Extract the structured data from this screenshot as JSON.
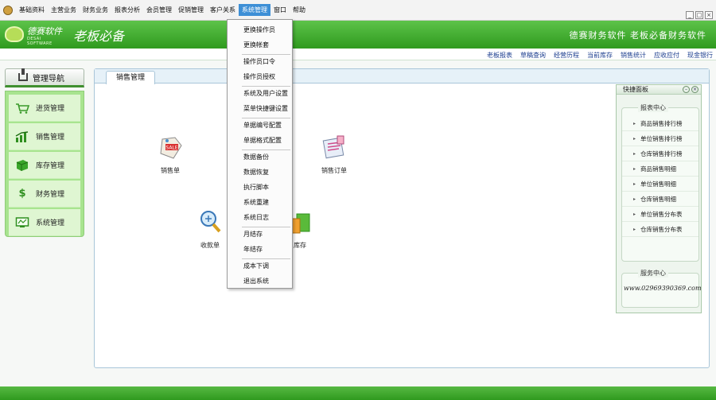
{
  "menubar": {
    "items": [
      "基础资料",
      "主营业务",
      "财务业务",
      "报表分析",
      "会员管理",
      "促销管理",
      "客户关系",
      "系统管理",
      "窗口",
      "帮助"
    ],
    "active_index": 7
  },
  "window_controls": [
    "_",
    "□",
    "×"
  ],
  "banner": {
    "logo_name": "德赛软件",
    "logo_sub": "DESAI SOFTWARE",
    "title": "老板必备",
    "slogan": "德赛财务软件 老板必备财务软件"
  },
  "quicklinks": [
    "老板报表",
    "草稿查询",
    "经营历程",
    "当前库存",
    "销售统计",
    "应收应付",
    "现金银行"
  ],
  "nav": {
    "header": "管理导航",
    "items": [
      {
        "label": "进货管理",
        "icon": "shopping-cart-icon"
      },
      {
        "label": "销售管理",
        "icon": "sales-chart-icon"
      },
      {
        "label": "库存管理",
        "icon": "inventory-icon"
      },
      {
        "label": "财务管理",
        "icon": "dollar-icon"
      },
      {
        "label": "系统管理",
        "icon": "system-monitor-icon"
      }
    ]
  },
  "content": {
    "tab": "销售管理",
    "functions": [
      {
        "label": "销售单",
        "icon": "sale-tag-icon"
      },
      {
        "label": "销售订单",
        "icon": "sales-order-icon"
      },
      {
        "label": "收款单",
        "icon": "receipt-magnifier-icon"
      },
      {
        "label": "库存",
        "icon": "stock-bag-icon"
      }
    ]
  },
  "quick_panel": {
    "title": "快捷面板",
    "report_center": {
      "title": "报表中心",
      "items": [
        "商品销售排行榜",
        "单位销售排行榜",
        "仓库销售排行榜",
        "商品销售明细",
        "单位销售明细",
        "仓库销售明细",
        "单位销售分布表",
        "仓库销售分布表"
      ]
    },
    "service_center": {
      "title": "服务中心",
      "text": "www.02969390369.com"
    }
  },
  "dropdown": {
    "items": [
      "更换操作员",
      "更换帐套",
      "操作员口令",
      "操作员授权",
      "系统及用户设置",
      "菜单快捷键设置",
      "单据编号配置",
      "单据格式配置",
      "数据备份",
      "数据恢复",
      "执行脚本",
      "系统重建",
      "系统日志",
      "月结存",
      "年结存",
      "成本下调",
      "退出系统"
    ]
  },
  "colors": {
    "brand_green": "#2f9a1e",
    "nav_green": "#a8e48f",
    "menu_highlight": "#3d8fd6",
    "link_blue": "#1d3f8f"
  }
}
